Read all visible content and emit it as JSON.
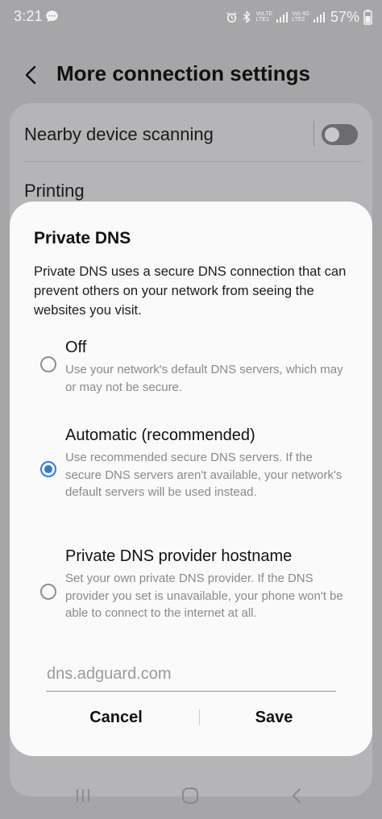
{
  "status_bar": {
    "time": "3:21",
    "battery": "57%",
    "sim1_top": "VoLTE",
    "sim1_bottom": "LTE1",
    "sim2_top": "Vo) 4G",
    "sim2_bottom": "LTE2",
    "icons": [
      "chat-icon",
      "alarm-icon",
      "bluetooth-icon",
      "signal-icon",
      "battery-icon"
    ]
  },
  "header": {
    "title": "More connection settings"
  },
  "settings": {
    "nearby_label": "Nearby device scanning",
    "nearby_toggle_on": false,
    "printing_label": "Printing"
  },
  "dialog": {
    "title": "Private DNS",
    "description": "Private DNS uses a secure DNS connection that can prevent others on your network from seeing the websites you visit.",
    "options": [
      {
        "title": "Off",
        "description": "Use your network's default DNS servers, which may or may not be secure.",
        "selected": false
      },
      {
        "title": "Automatic (recommended)",
        "description": "Use recommended secure DNS servers. If the secure DNS servers aren't available, your network's default servers will be used instead.",
        "selected": true
      },
      {
        "title": "Private DNS provider hostname",
        "description": "Set your own private DNS provider. If the DNS provider you set is unavailable, your phone won't be able to connect to the internet at all.",
        "selected": false
      }
    ],
    "hostname_placeholder": "dns.adguard.com",
    "hostname_value": "",
    "cancel_label": "Cancel",
    "save_label": "Save"
  },
  "colors": {
    "accent": "#3478e8",
    "dimmed_background": "#a6a6a8",
    "dialog_background": "#fafafa"
  }
}
